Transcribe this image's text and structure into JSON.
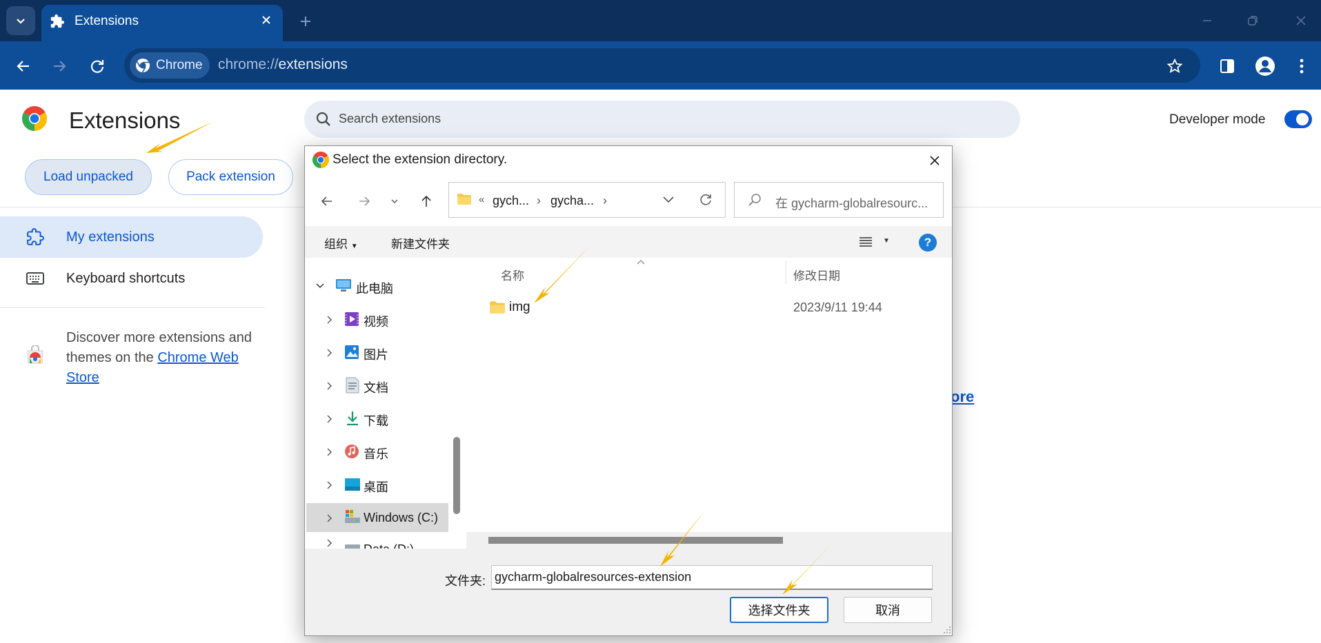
{
  "browser": {
    "tab_title": "Extensions",
    "chip_label": "Chrome",
    "url_scheme": "chrome://",
    "url_path": "extensions"
  },
  "page": {
    "title": "Extensions",
    "search_placeholder": "Search extensions",
    "developer_mode_label": "Developer mode",
    "developer_mode_on": true,
    "load_unpacked": "Load unpacked",
    "pack_extension": "Pack extension",
    "nav": {
      "my_extensions": "My extensions",
      "keyboard_shortcuts": "Keyboard shortcuts"
    },
    "discover_text": "Discover more extensions and themes on the ",
    "discover_link": "Chrome Web Store",
    "peek_link": "ore"
  },
  "dialog": {
    "title": "Select the extension directory.",
    "breadcrumb": [
      "gych...",
      "gycha..."
    ],
    "breadcrumb_prefix": "«",
    "search_placeholder": "在 gycharm-globalresourc...",
    "organize": "组织",
    "new_folder": "新建文件夹",
    "help": "?",
    "tree": [
      {
        "label": "此电脑",
        "icon": "computer-icon",
        "expanded": true
      },
      {
        "label": "视频",
        "icon": "video-folder-icon"
      },
      {
        "label": "图片",
        "icon": "pictures-folder-icon"
      },
      {
        "label": "文档",
        "icon": "documents-folder-icon"
      },
      {
        "label": "下载",
        "icon": "downloads-folder-icon"
      },
      {
        "label": "音乐",
        "icon": "music-folder-icon"
      },
      {
        "label": "桌面",
        "icon": "desktop-folder-icon"
      },
      {
        "label": "Windows (C:)",
        "icon": "drive-icon",
        "selected": true
      },
      {
        "label": "Data (D:)",
        "icon": "drive-icon"
      }
    ],
    "columns": {
      "name": "名称",
      "modified": "修改日期"
    },
    "files": [
      {
        "name": "img",
        "modified": "2023/9/11 19:44"
      }
    ],
    "folder_label": "文件夹:",
    "folder_value": "gycharm-globalresources-extension",
    "select_button": "选择文件夹",
    "cancel_button": "取消"
  },
  "colors": {
    "titlebar": "#0d2f5c",
    "toolbar": "#0e4d97",
    "accent": "#0b57d0",
    "annotation_arrow": "#f5b400"
  }
}
